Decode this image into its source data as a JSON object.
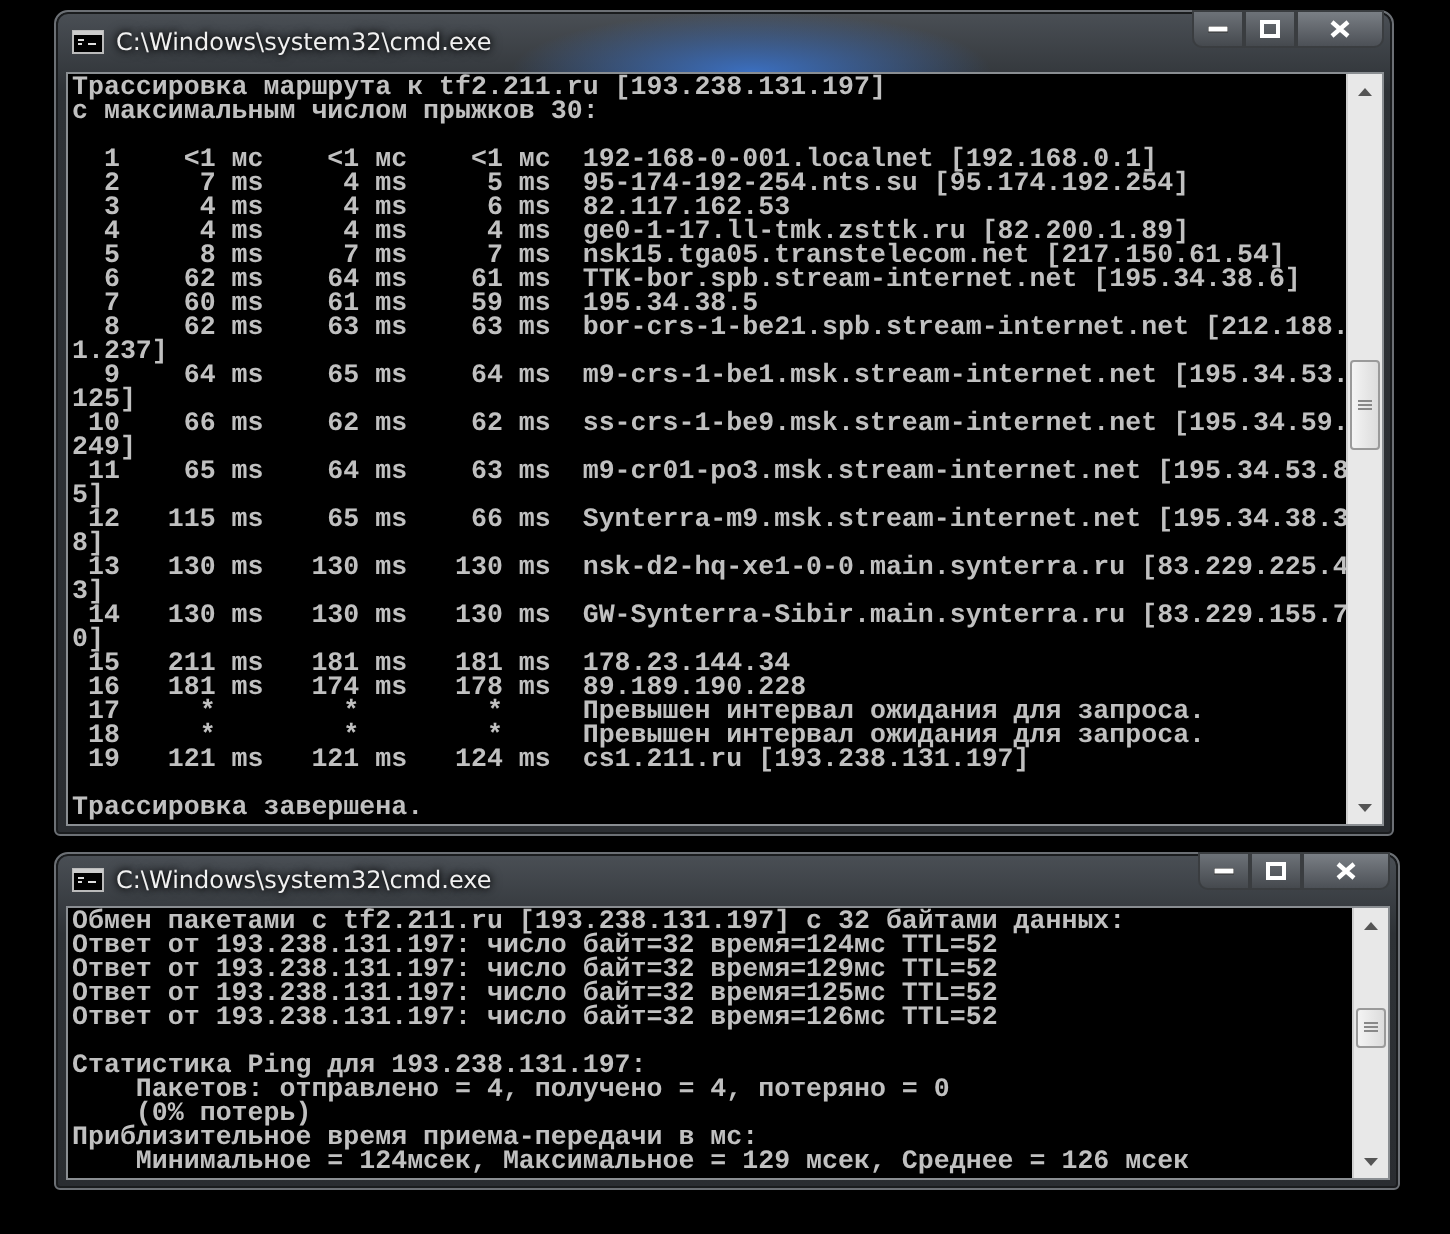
{
  "windows": [
    {
      "title": "C:\\Windows\\system32\\cmd.exe",
      "lines": [
        {
          "text": "Трассировка маршрута к tf2.211.ru [193.238.131.197]"
        },
        {
          "text": "с максимальным числом прыжков 30:"
        },
        {
          "text": "  1    <1 мс    <1 мс    <1 мс  192-168-0-001.localnet [192.168.0.1]",
          "gap_before": true
        },
        {
          "text": "  2     7 ms     4 ms     5 ms  95-174-192-254.nts.su [95.174.192.254]"
        },
        {
          "text": "  3     4 ms     4 ms     6 ms  82.117.162.53"
        },
        {
          "text": "  4     4 ms     4 ms     4 ms  ge0-1-17.ll-tmk.zsttk.ru [82.200.1.89]"
        },
        {
          "text": "  5     8 ms     7 ms     7 ms  nsk15.tga05.transtelecom.net [217.150.61.54]"
        },
        {
          "text": "  6    62 ms    64 ms    61 ms  TTK-bor.spb.stream-internet.net [195.34.38.6]"
        },
        {
          "text": "  7    60 ms    61 ms    59 ms  195.34.38.5"
        },
        {
          "text": "  8    62 ms    63 ms    63 ms  bor-crs-1-be21.spb.stream-internet.net [212.188."
        },
        {
          "text": "1.237]"
        },
        {
          "text": "  9    64 ms    65 ms    64 ms  m9-crs-1-be1.msk.stream-internet.net [195.34.53."
        },
        {
          "text": "125]"
        },
        {
          "text": " 10    66 ms    62 ms    62 ms  ss-crs-1-be9.msk.stream-internet.net [195.34.59."
        },
        {
          "text": "249]"
        },
        {
          "text": " 11    65 ms    64 ms    63 ms  m9-cr01-po3.msk.stream-internet.net [195.34.53.8"
        },
        {
          "text": "5]"
        },
        {
          "text": " 12   115 ms    65 ms    66 ms  Synterra-m9.msk.stream-internet.net [195.34.38.3"
        },
        {
          "text": "8]"
        },
        {
          "text": " 13   130 ms   130 ms   130 ms  nsk-d2-hq-xe1-0-0.main.synterra.ru [83.229.225.4"
        },
        {
          "text": "3]"
        },
        {
          "text": " 14   130 ms   130 ms   130 ms  GW-Synterra-Sibir.main.synterra.ru [83.229.155.7"
        },
        {
          "text": "0]"
        },
        {
          "text": " 15   211 ms   181 ms   181 ms  178.23.144.34"
        },
        {
          "text": " 16   181 ms   174 ms   178 ms  89.189.190.228"
        },
        {
          "text": " 17     *        *        *     Превышен интервал ожидания для запроса."
        },
        {
          "text": " 18     *        *        *     Превышен интервал ожидания для запроса."
        },
        {
          "text": " 19   121 ms   121 ms   124 ms  cs1.211.ru [193.238.131.197]"
        },
        {
          "text": "Трассировка завершена.",
          "gap_before": true
        }
      ]
    },
    {
      "title": "C:\\Windows\\system32\\cmd.exe",
      "lines": [
        {
          "text": "Обмен пакетами с tf2.211.ru [193.238.131.197] с 32 байтами данных:"
        },
        {
          "text": "Ответ от 193.238.131.197: число байт=32 время=124мс TTL=52"
        },
        {
          "text": "Ответ от 193.238.131.197: число байт=32 время=129мс TTL=52"
        },
        {
          "text": "Ответ от 193.238.131.197: число байт=32 время=125мс TTL=52"
        },
        {
          "text": "Ответ от 193.238.131.197: число байт=32 время=126мс TTL=52"
        },
        {
          "text": "Статистика Ping для 193.238.131.197:",
          "gap_before": true
        },
        {
          "text": "    Пакетов: отправлено = 4, получено = 4, потеряно = 0"
        },
        {
          "text": "    (0% потерь)"
        },
        {
          "text": "Приблизительное время приема-передачи в мс:"
        },
        {
          "text": "    Минимальное = 124мсек, Максимальное = 129 мсек, Среднее = 126 мсек"
        }
      ]
    }
  ]
}
